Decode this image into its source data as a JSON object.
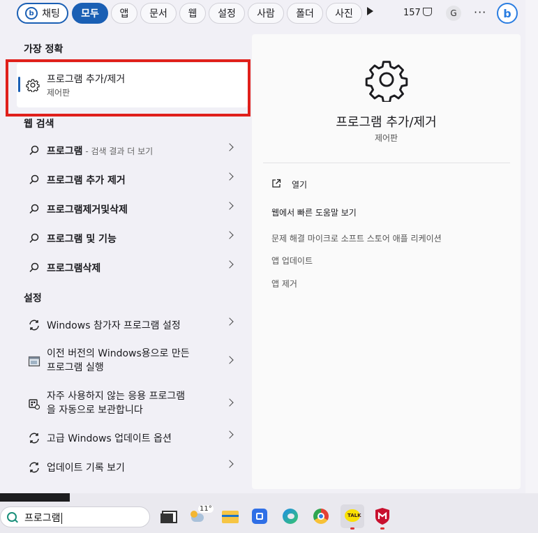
{
  "filters": {
    "chat": "채팅",
    "all": "모두",
    "apps": "앱",
    "documents": "문서",
    "web": "웹",
    "settings": "설정",
    "people": "사람",
    "folders": "폴더",
    "photos": "사진"
  },
  "rewards_points": "157",
  "account_initial": "G",
  "more_label": "···",
  "sections": {
    "best_match": "가장 정확",
    "web_search": "웹 검색",
    "settings": "설정"
  },
  "best_match": {
    "title": "프로그램 추가/제거",
    "subtitle": "제어판"
  },
  "web_results": [
    {
      "text": "프로그램",
      "hint": " - 검색 결과 더 보기",
      "icon": "search-icon"
    },
    {
      "text": "프로그램 추가 제거",
      "hint": "",
      "icon": "search-icon"
    },
    {
      "text": "프로그램제거및삭제",
      "hint": "",
      "icon": "search-icon"
    },
    {
      "text": "프로그램 및 기능",
      "hint": "",
      "icon": "search-icon"
    },
    {
      "text": "프로그램삭제",
      "hint": "",
      "icon": "search-icon"
    }
  ],
  "settings_results": [
    {
      "line1": "Windows 참가자 프로그램 설정",
      "line2": "",
      "icon": "sync-icon"
    },
    {
      "line1": "이전 버전의 Windows용으로 만든",
      "line2": "프로그램 실행",
      "icon": "compat-window-icon"
    },
    {
      "line1": "자주 사용하지 않는 응용 프로그램",
      "line2": "을 자동으로 보관합니다",
      "icon": "archive-app-icon"
    },
    {
      "line1": "고급 Windows 업데이트 옵션",
      "line2": "",
      "icon": "sync-icon"
    },
    {
      "line1": "업데이트 기록 보기",
      "line2": "",
      "icon": "sync-icon"
    }
  ],
  "detail": {
    "title": "프로그램 추가/제거",
    "subtitle": "제어판",
    "open_label": "열기",
    "web_help_heading": "웹에서 빠른 도움말 보기",
    "help_links": [
      "문제 해결 마이크로 소프트 스토어 애플 리케이션",
      "앱 업데이트",
      "앱 제거"
    ]
  },
  "taskbar": {
    "search_value": "프로그램",
    "weather_temp": "11°"
  },
  "colors": {
    "accent": "#1a5fb4",
    "highlight_box": "#e0201b"
  }
}
